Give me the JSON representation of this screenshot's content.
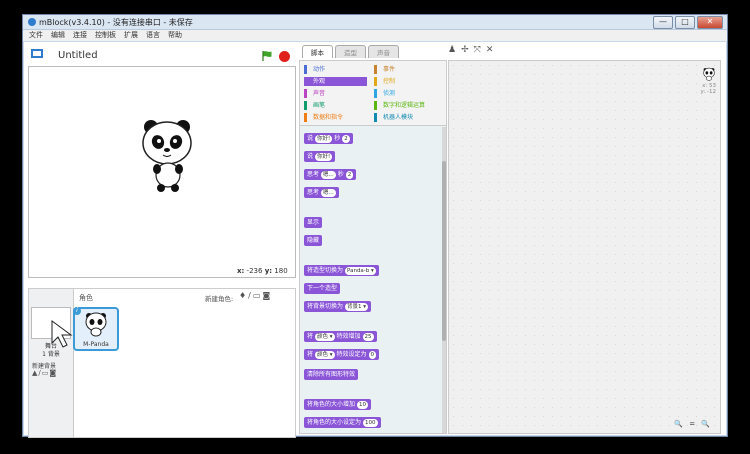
{
  "window": {
    "title": "mBlock(v3.4.10) - 没有连接串口 - 未保存",
    "buttons": {
      "minimize": "—",
      "maximize": "□",
      "close": "✕"
    }
  },
  "menu": [
    "文件",
    "编辑",
    "连接",
    "控制板",
    "扩展",
    "语言",
    "帮助"
  ],
  "stage": {
    "project_title": "Untitled",
    "coords": {
      "x_label": "x:",
      "x_value": "-236",
      "y_label": "y:",
      "y_value": "180"
    }
  },
  "sprites": {
    "header": "角色",
    "new_sprite_label": "新建角色:",
    "stage_label": "舞台",
    "stage_bg_count": "1 背景",
    "new_backdrop_label": "新建背景",
    "sprite_name": "M-Panda"
  },
  "tabs": [
    "脚本",
    "造型",
    "声音"
  ],
  "categories": [
    {
      "label": "动作",
      "color": "#4a6cd4"
    },
    {
      "label": "事件",
      "color": "#c88330"
    },
    {
      "label": "外观",
      "color": "#8a55d7"
    },
    {
      "label": "控制",
      "color": "#e1a91a"
    },
    {
      "label": "声音",
      "color": "#bb42c3"
    },
    {
      "label": "侦测",
      "color": "#2ca5e2"
    },
    {
      "label": "画笔",
      "color": "#0e9a6c"
    },
    {
      "label": "数字和逻辑运算",
      "color": "#5cb712"
    },
    {
      "label": "数据和指令",
      "color": "#ee7d16"
    },
    {
      "label": "机器人模块",
      "color": "#0f8bb0"
    }
  ],
  "blocks": [
    {
      "pre": "说",
      "input": "你好!",
      "post": "2",
      "suffix": "秒"
    },
    {
      "pre": "说",
      "input": "你好!",
      "post": "",
      "suffix": ""
    },
    {
      "pre": "思考",
      "input": "嗯...",
      "post": "2",
      "suffix": "秒"
    },
    {
      "pre": "思考",
      "input": "嗯...",
      "post": "",
      "suffix": ""
    },
    {
      "pre": "显示",
      "input": "",
      "post": "",
      "suffix": ""
    },
    {
      "pre": "隐藏",
      "input": "",
      "post": "",
      "suffix": ""
    },
    {
      "pre": "将造型切换为",
      "input": "Panda-b ▾",
      "post": "",
      "suffix": ""
    },
    {
      "pre": "下一个造型",
      "input": "",
      "post": "",
      "suffix": ""
    },
    {
      "pre": "将背景切换为",
      "input": "背景1 ▾",
      "post": "",
      "suffix": ""
    },
    {
      "pre": "将",
      "input": "颜色 ▾",
      "post": "25",
      "suffix": "特效增加"
    },
    {
      "pre": "将",
      "input": "颜色 ▾",
      "post": "0",
      "suffix": "特效设定为"
    },
    {
      "pre": "清除所有图形特效",
      "input": "",
      "post": "",
      "suffix": ""
    },
    {
      "pre": "将角色的大小增加",
      "input": "",
      "post": "10",
      "suffix": ""
    },
    {
      "pre": "将角色的大小设定为",
      "input": "",
      "post": "100",
      "suffix": ""
    }
  ],
  "script_area": {
    "sprite_x": "x: 53",
    "sprite_y": "y: -12",
    "zoom_controls": "🔍 = 🔍"
  }
}
